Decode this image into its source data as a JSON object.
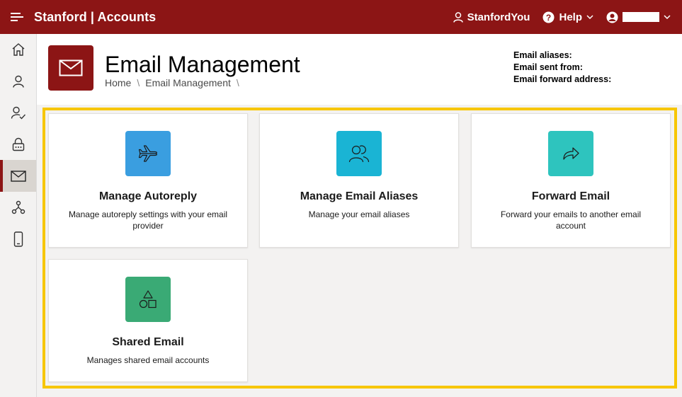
{
  "app": {
    "brand": "Stanford | Accounts"
  },
  "topbar": {
    "stanfordyou_label": "StanfordYou",
    "help_label": "Help"
  },
  "sidebar": {
    "items": [
      {
        "name": "home",
        "icon": "home-icon"
      },
      {
        "name": "profile",
        "icon": "person-icon"
      },
      {
        "name": "person-check",
        "icon": "person-check-icon"
      },
      {
        "name": "security",
        "icon": "lock-icon"
      },
      {
        "name": "email",
        "icon": "mail-icon",
        "active": true
      },
      {
        "name": "network",
        "icon": "network-icon"
      },
      {
        "name": "mobile",
        "icon": "phone-icon"
      }
    ]
  },
  "header": {
    "title": "Email Management",
    "breadcrumb": [
      "Home",
      "Email Management"
    ],
    "breadcrumb_separator": "\\",
    "info": {
      "aliases_label": "Email aliases:",
      "sent_from_label": "Email sent from:",
      "forward_label": "Email forward address:"
    }
  },
  "colors": {
    "brand": "#8c1515",
    "highlight": "#f7c600",
    "autoreply": "#3a9ee0",
    "aliases": "#1ab4d4",
    "forward": "#2ec4be",
    "shared": "#3aaa75"
  },
  "cards": [
    {
      "title": "Manage Autoreply",
      "description": "Manage autoreply settings with your email provider",
      "icon": "airplane-icon"
    },
    {
      "title": "Manage Email Aliases",
      "description": "Manage your email aliases",
      "icon": "people-icon"
    },
    {
      "title": "Forward Email",
      "description": "Forward your emails to another email account",
      "icon": "forward-arrow-icon"
    },
    {
      "title": "Shared Email",
      "description": "Manages shared email accounts",
      "icon": "shapes-icon"
    }
  ]
}
